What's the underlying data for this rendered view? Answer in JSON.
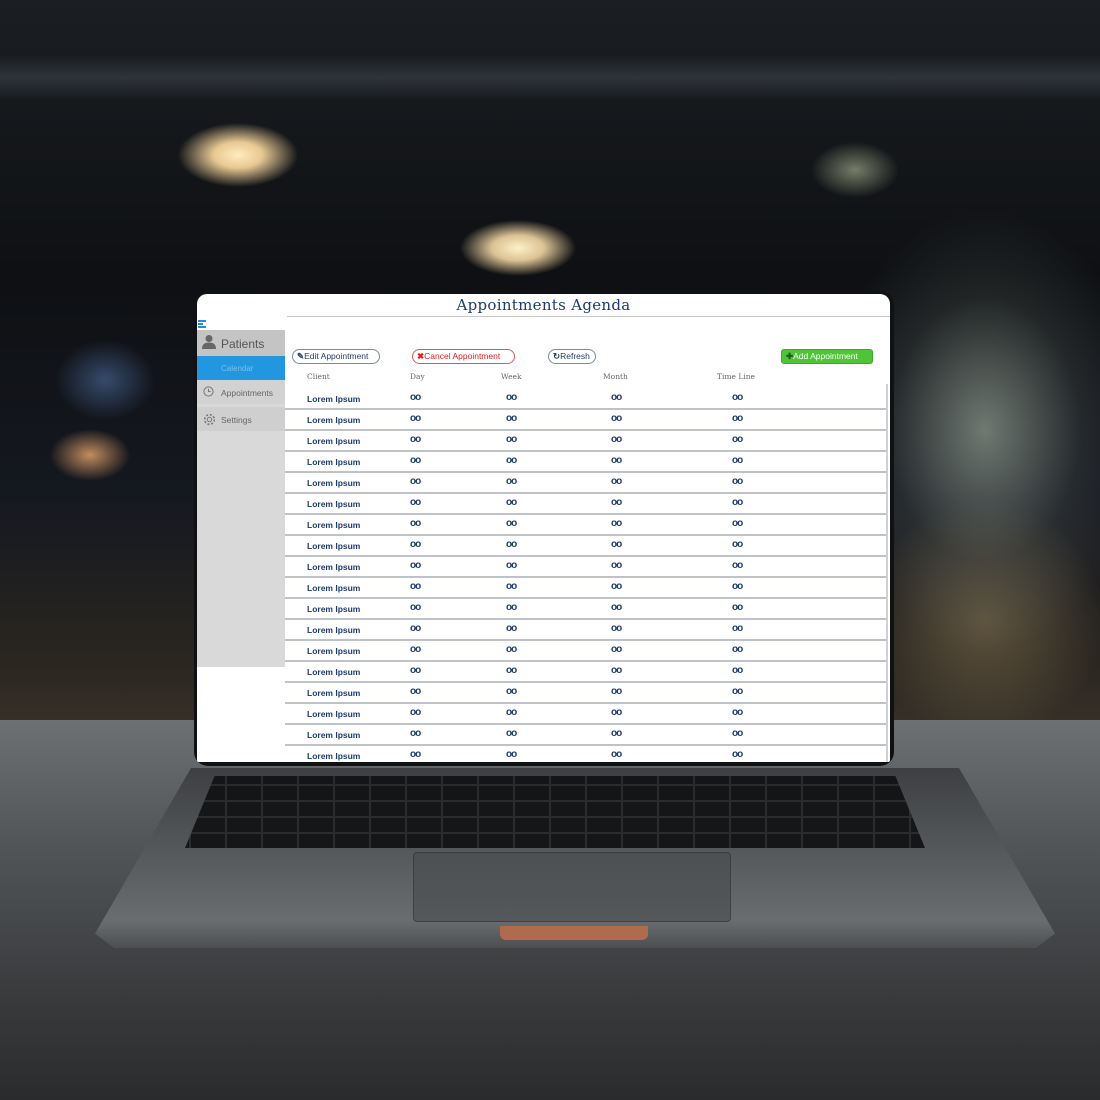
{
  "app": {
    "title": "Appointments Agenda"
  },
  "sidebar": {
    "header": {
      "label": "Patients",
      "icon": "user-icon"
    },
    "active_item": {
      "label": "Calendar"
    },
    "items": [
      {
        "label": "Appointments",
        "icon": "clock-icon"
      },
      {
        "label": "Settings",
        "icon": "gear-icon"
      }
    ]
  },
  "toolbar": {
    "edit_label": "Edit Appointment",
    "cancel_label": "Cancel  Appointment",
    "refresh_label": "Refresh",
    "add_label": "Add Appointment",
    "accent_add": "#4fc436",
    "accent_cancel": "#e01e1e"
  },
  "table": {
    "columns": [
      "Client",
      "Day",
      "Week",
      "Month",
      "Time Line"
    ],
    "rows": [
      [
        "Lorem Ipsum",
        "oo",
        "oo",
        "oo",
        "oo"
      ],
      [
        "Lorem Ipsum",
        "oo",
        "oo",
        "oo",
        "oo"
      ],
      [
        "Lorem Ipsum",
        "oo",
        "oo",
        "oo",
        "oo"
      ],
      [
        "Lorem Ipsum",
        "oo",
        "oo",
        "oo",
        "oo"
      ],
      [
        "Lorem Ipsum",
        "oo",
        "oo",
        "oo",
        "oo"
      ],
      [
        "Lorem Ipsum",
        "oo",
        "oo",
        "oo",
        "oo"
      ],
      [
        "Lorem Ipsum",
        "oo",
        "oo",
        "oo",
        "oo"
      ],
      [
        "Lorem Ipsum",
        "oo",
        "oo",
        "oo",
        "oo"
      ],
      [
        "Lorem Ipsum",
        "oo",
        "oo",
        "oo",
        "oo"
      ],
      [
        "Lorem Ipsum",
        "oo",
        "oo",
        "oo",
        "oo"
      ],
      [
        "Lorem Ipsum",
        "oo",
        "oo",
        "oo",
        "oo"
      ],
      [
        "Lorem Ipsum",
        "oo",
        "oo",
        "oo",
        "oo"
      ],
      [
        "Lorem Ipsum",
        "oo",
        "oo",
        "oo",
        "oo"
      ],
      [
        "Lorem Ipsum",
        "oo",
        "oo",
        "oo",
        "oo"
      ],
      [
        "Lorem Ipsum",
        "oo",
        "oo",
        "oo",
        "oo"
      ],
      [
        "Lorem Ipsum",
        "oo",
        "oo",
        "oo",
        "oo"
      ],
      [
        "Lorem Ipsum",
        "oo",
        "oo",
        "oo",
        "oo"
      ],
      [
        "Lorem Ipsum",
        "oo",
        "oo",
        "oo",
        "oo"
      ]
    ]
  }
}
